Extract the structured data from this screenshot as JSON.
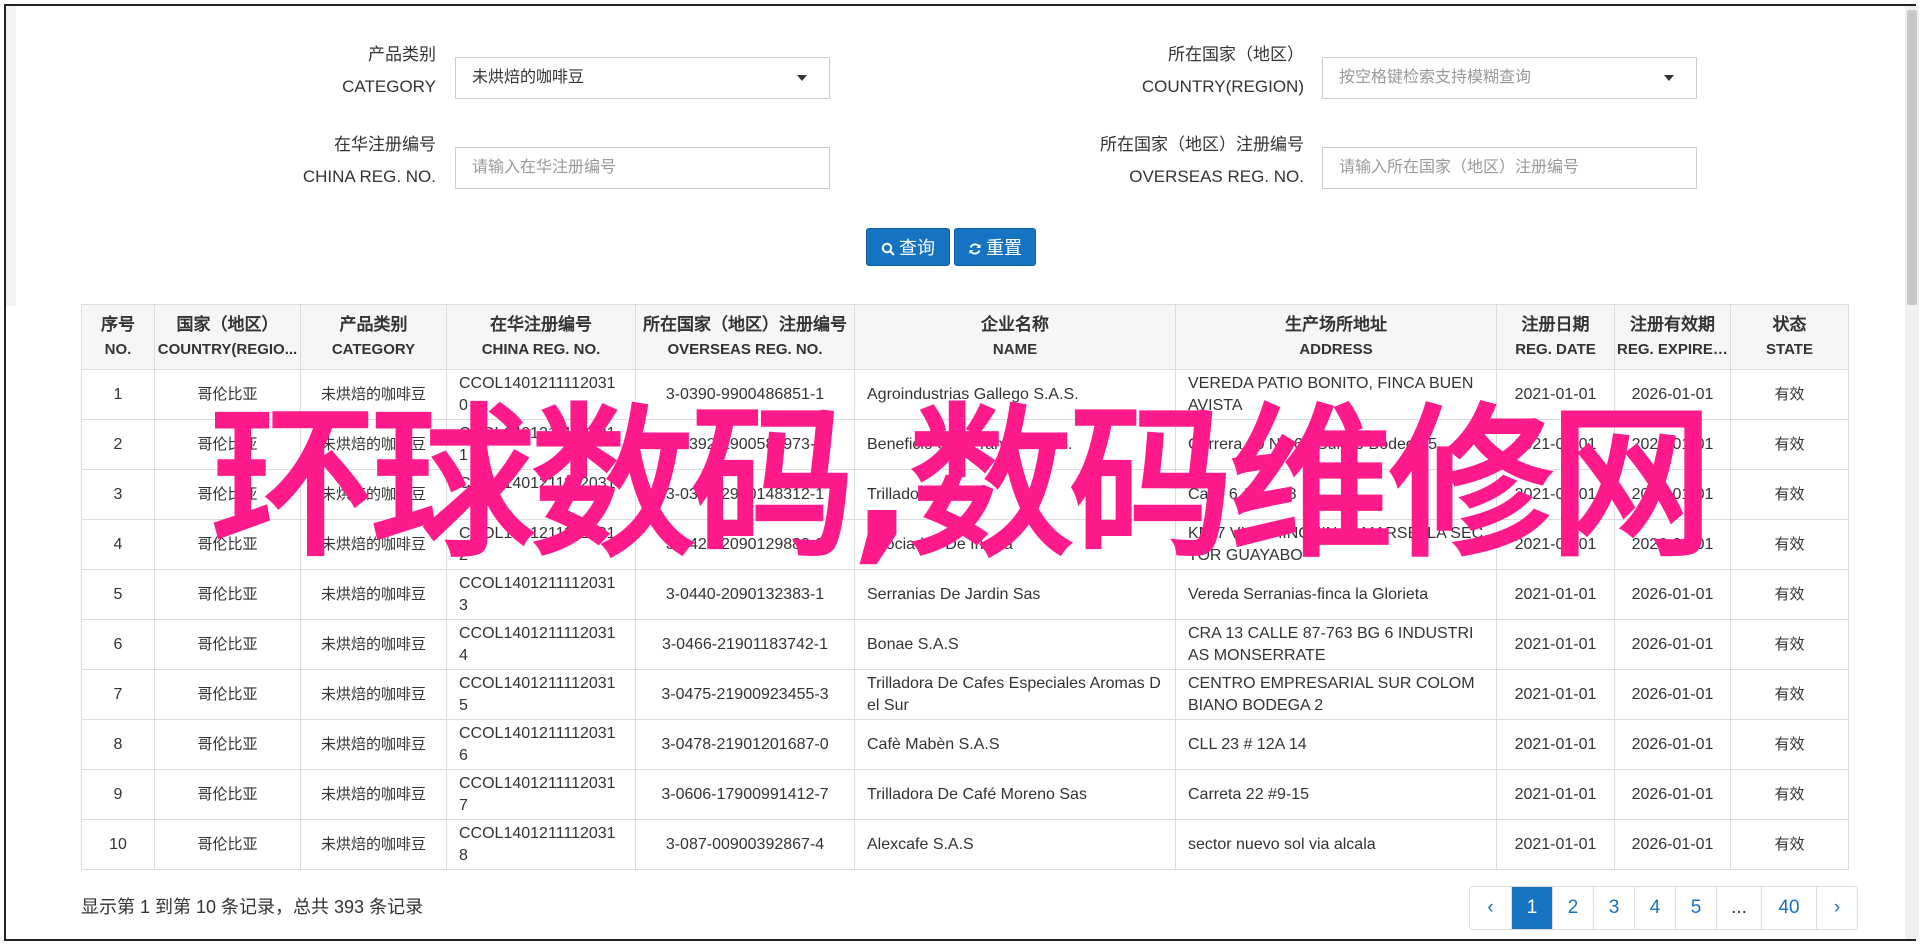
{
  "form": {
    "category_label_cn": "产品类别",
    "category_label_en": "CATEGORY",
    "category_value": "未烘焙的咖啡豆",
    "country_label_cn": "所在国家（地区）",
    "country_label_en": "COUNTRY(REGION)",
    "country_placeholder": "按空格键检索支持模糊查询",
    "china_reg_label_cn": "在华注册编号",
    "china_reg_label_en": "CHINA REG. NO.",
    "china_reg_placeholder": "请输入在华注册编号",
    "overseas_reg_label_cn": "所在国家（地区）注册编号",
    "overseas_reg_label_en": "OVERSEAS REG. NO.",
    "overseas_reg_placeholder": "请输入所在国家（地区）注册编号",
    "search_label": "查询",
    "reset_label": "重置"
  },
  "table": {
    "headers": [
      {
        "cn": "序号",
        "en": "NO."
      },
      {
        "cn": "国家（地区）",
        "en": "COUNTRY(REGIO..."
      },
      {
        "cn": "产品类别",
        "en": "CATEGORY"
      },
      {
        "cn": "在华注册编号",
        "en": "CHINA REG. NO."
      },
      {
        "cn": "所在国家（地区）注册编号",
        "en": "OVERSEAS REG. NO."
      },
      {
        "cn": "企业名称",
        "en": "NAME"
      },
      {
        "cn": "生产场所地址",
        "en": "ADDRESS"
      },
      {
        "cn": "注册日期",
        "en": "REG. DATE"
      },
      {
        "cn": "注册有效期",
        "en": "REG. EXPIRE ..."
      },
      {
        "cn": "状态",
        "en": "STATE"
      }
    ],
    "rows": [
      [
        "1",
        "哥伦比亚",
        "未烘焙的咖啡豆",
        "CCOL14012111120310",
        "3-0390-9900486851-1",
        "Agroindustrias Gallego S.A.S.",
        "VEREDA PATIO BONITO, FINCA BUEN AVISTA",
        "2021-01-01",
        "2026-01-01",
        "有效"
      ],
      [
        "2",
        "哥伦比亚",
        "未烘焙的咖啡豆",
        "CCOL14012111120311",
        "3-0392-1900586973-0",
        "Beneficio San Francis S.A.S.",
        "Carrera 30 No 6 - Sur 40 Bodega 5",
        "2021-01-01",
        "2026-01-01",
        "有效"
      ],
      [
        "3",
        "哥伦比亚",
        "未烘焙的咖啡豆",
        "CCOL14012111120317",
        "3-0398-2900148312-1",
        "Trillador Nova",
        "Calle 6 # 6 - 28",
        "2021-01-01",
        "2026-01-01",
        "有效"
      ],
      [
        "4",
        "哥伦比亚",
        "未烘焙的咖啡豆",
        "CCOL14012111120312",
        "3-0428-2090129883-9",
        "Asociados De Insula",
        "KM 7 VIA CHINCHINA - MARSELLA SECTOR GUAYABO",
        "2021-01-01",
        "2026-01-01",
        "有效"
      ],
      [
        "5",
        "哥伦比亚",
        "未烘焙的咖啡豆",
        "CCOL14012111120313",
        "3-0440-2090132383-1",
        "Serranias De Jardin Sas",
        "Vereda Serranias-finca la Glorieta",
        "2021-01-01",
        "2026-01-01",
        "有效"
      ],
      [
        "6",
        "哥伦比亚",
        "未烘焙的咖啡豆",
        "CCOL14012111120314",
        "3-0466-21901183742-1",
        "Bonae S.A.S",
        "CRA 13 CALLE 87-763 BG 6 INDUSTRIAS MONSERRATE",
        "2021-01-01",
        "2026-01-01",
        "有效"
      ],
      [
        "7",
        "哥伦比亚",
        "未烘焙的咖啡豆",
        "CCOL14012111120315",
        "3-0475-21900923455-3",
        "Trilladora De Cafes Especiales Aromas Del Sur",
        "CENTRO EMPRESARIAL SUR COLOMBIANO BODEGA 2",
        "2021-01-01",
        "2026-01-01",
        "有效"
      ],
      [
        "8",
        "哥伦比亚",
        "未烘焙的咖啡豆",
        "CCOL14012111120316",
        "3-0478-21901201687-0",
        "Cafè Mabèn S.A.S",
        "CLL 23 # 12A 14",
        "2021-01-01",
        "2026-01-01",
        "有效"
      ],
      [
        "9",
        "哥伦比亚",
        "未烘焙的咖啡豆",
        "CCOL14012111120317",
        "3-0606-17900991412-7",
        "Trilladora De Café Moreno Sas",
        "Carreta 22 #9-15",
        "2021-01-01",
        "2026-01-01",
        "有效"
      ],
      [
        "10",
        "哥伦比亚",
        "未烘焙的咖啡豆",
        "CCOL14012111120318",
        "3-087-00900392867-4",
        "Alexcafe S.A.S",
        "sector nuevo sol via alcala",
        "2021-01-01",
        "2026-01-01",
        "有效"
      ]
    ]
  },
  "overlay_text": "环球数码,数码维修网",
  "summary": "显示第 1 到第 10 条记录，总共 393 条记录",
  "pagination": {
    "prev": "‹",
    "pages": [
      "1",
      "2",
      "3",
      "4",
      "5",
      "...",
      "40"
    ],
    "next": "›",
    "active": "1"
  },
  "colors": {
    "primary": "#1573c2",
    "overlay": "#ff1a8c"
  }
}
